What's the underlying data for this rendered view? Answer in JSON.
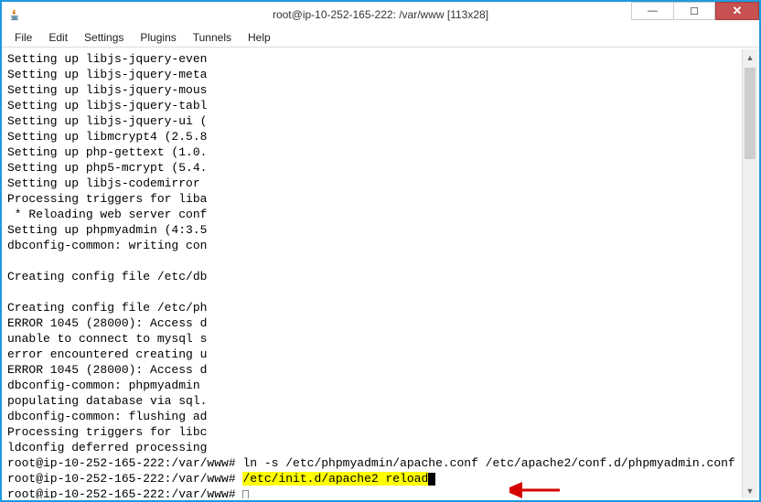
{
  "window": {
    "title": "root@ip-10-252-165-222: /var/www [113x28]"
  },
  "menu": {
    "items": [
      "File",
      "Edit",
      "Settings",
      "Plugins",
      "Tunnels",
      "Help"
    ]
  },
  "terminal": {
    "lines": [
      "Setting up libjs-jquery-even",
      "Setting up libjs-jquery-meta",
      "Setting up libjs-jquery-mous",
      "Setting up libjs-jquery-tabl",
      "Setting up libjs-jquery-ui (",
      "Setting up libmcrypt4 (2.5.8",
      "Setting up php-gettext (1.0.",
      "Setting up php5-mcrypt (5.4.",
      "Setting up libjs-codemirror ",
      "Processing triggers for liba",
      " * Reloading web server conf",
      "Setting up phpmyadmin (4:3.5",
      "dbconfig-common: writing con",
      "",
      "Creating config file /etc/db",
      "",
      "Creating config file /etc/ph",
      "ERROR 1045 (28000): Access d",
      "unable to connect to mysql s",
      "error encountered creating u",
      "ERROR 1045 (28000): Access d",
      "dbconfig-common: phpmyadmin ",
      "populating database via sql.",
      "dbconfig-common: flushing ad",
      "Processing triggers for libc",
      "ldconfig deferred processing"
    ],
    "prompt1_prefix": "root@ip-10-252-165-222:/var/www# ",
    "prompt1_cmd": "ln -s /etc/phpmyadmin/apache.conf /etc/apache2/conf.d/phpmyadmin.conf",
    "prompt2_prefix": "root@ip-10-252-165-222:/var/www# ",
    "prompt2_cmd": "/etc/init.d/apache2 reload",
    "prompt3_prefix": "root@ip-10-252-165-222:/var/www# "
  },
  "annotation": {
    "arrow_color": "#d40000"
  }
}
